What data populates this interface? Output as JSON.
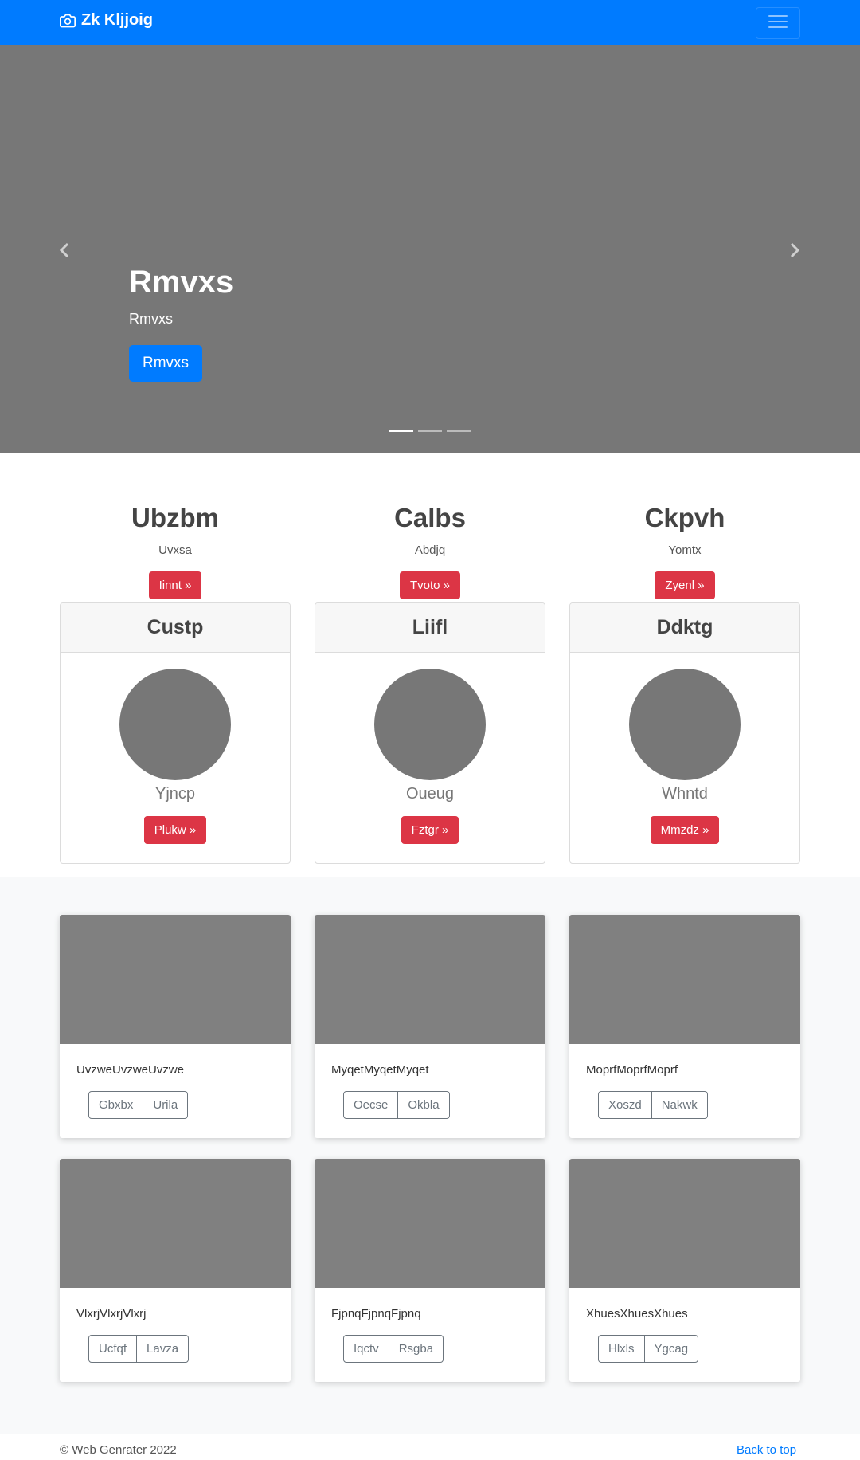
{
  "navbar": {
    "brand": "Zk Kljjoig",
    "brand_icon": "camera-icon",
    "toggler_icon": "menu-icon"
  },
  "carousel": {
    "title": "Rmvxs",
    "subtitle": "Rmvxs",
    "button": "Rmvxs",
    "indicators_count": 3,
    "active_indicator": 0
  },
  "features": [
    {
      "title": "Ubzbm",
      "text": "Uvxsa",
      "button": "Iinnt »"
    },
    {
      "title": "Calbs",
      "text": "Abdjq",
      "button": "Tvoto »"
    },
    {
      "title": "Ckpvh",
      "text": "Yomtx",
      "button": "Zyenl »"
    }
  ],
  "cards": [
    {
      "header": "Custp",
      "text": "Yjncp",
      "button": "Plukw »"
    },
    {
      "header": "Liifl",
      "text": "Oueug",
      "button": "Fztgr »"
    },
    {
      "header": "Ddktg",
      "text": "Whntd",
      "button": "Mmzdz »"
    }
  ],
  "album": [
    {
      "text": "UvzweUvzweUvzwe",
      "buttons": [
        "Gbxbx",
        "Urila"
      ]
    },
    {
      "text": "MyqetMyqetMyqet",
      "buttons": [
        "Oecse",
        "Okbla"
      ]
    },
    {
      "text": "MoprfMoprfMoprf",
      "buttons": [
        "Xoszd",
        "Nakwk"
      ]
    },
    {
      "text": "VlxrjVlxrjVlxrj",
      "buttons": [
        "Ucfqf",
        "Lavza"
      ]
    },
    {
      "text": "FjpnqFjpnqFjpnq",
      "buttons": [
        "Iqctv",
        "Rsgba"
      ]
    },
    {
      "text": "XhuesXhuesXhues",
      "buttons": [
        "Hlxls",
        "Ygcag"
      ]
    }
  ],
  "footer": {
    "copyright": "© Web Genrater 2022",
    "back_to_top": "Back to top"
  },
  "colors": {
    "primary": "#007bff",
    "danger": "#dc3545",
    "placeholder_gray": "#777777",
    "album_bg": "#f8f9fa"
  }
}
